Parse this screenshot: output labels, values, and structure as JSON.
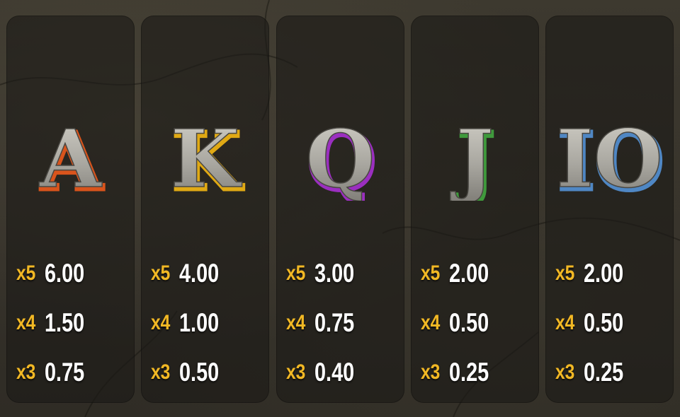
{
  "symbols": [
    {
      "id": "ace",
      "glyph": "A",
      "icon": "letter-a-icon",
      "accent": "#d9541c",
      "payouts": [
        {
          "mult": "x5",
          "value": "6.00"
        },
        {
          "mult": "x4",
          "value": "1.50"
        },
        {
          "mult": "x3",
          "value": "0.75"
        }
      ]
    },
    {
      "id": "king",
      "glyph": "K",
      "icon": "letter-k-icon",
      "accent": "#e0a914",
      "payouts": [
        {
          "mult": "x5",
          "value": "4.00"
        },
        {
          "mult": "x4",
          "value": "1.00"
        },
        {
          "mult": "x3",
          "value": "0.50"
        }
      ]
    },
    {
      "id": "queen",
      "glyph": "Q",
      "icon": "letter-q-icon",
      "accent": "#9b2fc0",
      "payouts": [
        {
          "mult": "x5",
          "value": "3.00"
        },
        {
          "mult": "x4",
          "value": "0.75"
        },
        {
          "mult": "x3",
          "value": "0.40"
        }
      ]
    },
    {
      "id": "jack",
      "glyph": "J",
      "icon": "letter-j-icon",
      "accent": "#3f9a3c",
      "payouts": [
        {
          "mult": "x5",
          "value": "2.00"
        },
        {
          "mult": "x4",
          "value": "0.50"
        },
        {
          "mult": "x3",
          "value": "0.25"
        }
      ]
    },
    {
      "id": "ten",
      "glyph": "IO",
      "icon": "ten-icon",
      "accent": "#4f87c4",
      "payouts": [
        {
          "mult": "x5",
          "value": "2.00"
        },
        {
          "mult": "x4",
          "value": "0.50"
        },
        {
          "mult": "x3",
          "value": "0.25"
        }
      ]
    }
  ],
  "colors": {
    "multiplier": "#f2b824",
    "value": "#ffffff",
    "panel": "#1c1a16",
    "background": "#3a362c",
    "metal_light": "#d2d0c8",
    "metal_dark": "#7c7a74"
  }
}
